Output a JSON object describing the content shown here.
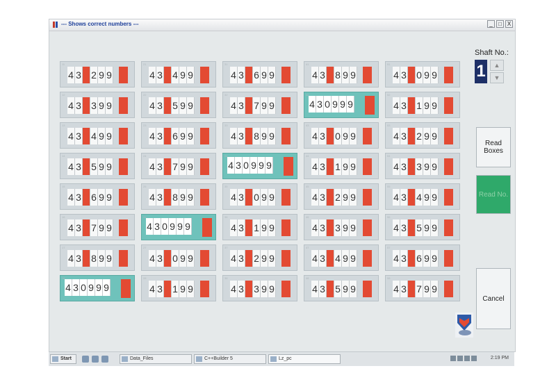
{
  "window": {
    "title": "--- Shows correct numbers ---",
    "controls": {
      "minimize": "_",
      "maximize": "□",
      "close": "X"
    }
  },
  "shaft": {
    "label": "Shaft No.:",
    "value": "1"
  },
  "buttons": {
    "read_boxes": "Read Boxes",
    "read_no": "Read No.",
    "cancel": "Cancel"
  },
  "boxes": [
    {
      "index": 11,
      "digits": [
        "4",
        "3",
        "0",
        "2",
        "9",
        "9"
      ],
      "highlighted": false
    },
    {
      "index": 21,
      "digits": [
        "4",
        "3",
        "0",
        "4",
        "9",
        "9"
      ],
      "highlighted": false
    },
    {
      "index": 31,
      "digits": [
        "4",
        "3",
        "0",
        "6",
        "9",
        "9"
      ],
      "highlighted": false
    },
    {
      "index": 41,
      "digits": [
        "4",
        "3",
        "0",
        "8",
        "9",
        "9"
      ],
      "highlighted": false
    },
    {
      "index": 51,
      "digits": [
        "4",
        "3",
        "0",
        "0",
        "9",
        "9"
      ],
      "highlighted": false
    },
    {
      "index": 12,
      "digits": [
        "4",
        "3",
        "0",
        "3",
        "9",
        "9"
      ],
      "highlighted": false
    },
    {
      "index": 22,
      "digits": [
        "4",
        "3",
        "0",
        "5",
        "9",
        "9"
      ],
      "highlighted": false
    },
    {
      "index": 32,
      "digits": [
        "4",
        "3",
        "0",
        "7",
        "9",
        "9"
      ],
      "highlighted": false
    },
    {
      "index": 42,
      "digits": [
        "4",
        "3",
        "0",
        "9",
        "9",
        "9"
      ],
      "highlighted": true
    },
    {
      "index": 52,
      "digits": [
        "4",
        "3",
        "0",
        "1",
        "9",
        "9"
      ],
      "highlighted": false
    },
    {
      "index": 13,
      "digits": [
        "4",
        "3",
        "0",
        "4",
        "9",
        "9"
      ],
      "highlighted": false
    },
    {
      "index": 23,
      "digits": [
        "4",
        "3",
        "0",
        "6",
        "9",
        "9"
      ],
      "highlighted": false
    },
    {
      "index": 33,
      "digits": [
        "4",
        "3",
        "0",
        "8",
        "9",
        "9"
      ],
      "highlighted": false
    },
    {
      "index": 43,
      "digits": [
        "4",
        "3",
        "0",
        "0",
        "9",
        "9"
      ],
      "highlighted": false
    },
    {
      "index": 53,
      "digits": [
        "4",
        "3",
        "0",
        "2",
        "9",
        "9"
      ],
      "highlighted": false
    },
    {
      "index": 14,
      "digits": [
        "4",
        "3",
        "0",
        "5",
        "9",
        "9"
      ],
      "highlighted": false
    },
    {
      "index": 24,
      "digits": [
        "4",
        "3",
        "0",
        "7",
        "9",
        "9"
      ],
      "highlighted": false
    },
    {
      "index": 34,
      "digits": [
        "4",
        "3",
        "0",
        "9",
        "9",
        "9"
      ],
      "highlighted": true
    },
    {
      "index": 44,
      "digits": [
        "4",
        "3",
        "0",
        "1",
        "9",
        "9"
      ],
      "highlighted": false
    },
    {
      "index": 54,
      "digits": [
        "4",
        "3",
        "0",
        "3",
        "9",
        "9"
      ],
      "highlighted": false
    },
    {
      "index": 15,
      "digits": [
        "4",
        "3",
        "0",
        "6",
        "9",
        "9"
      ],
      "highlighted": false
    },
    {
      "index": 25,
      "digits": [
        "4",
        "3",
        "0",
        "8",
        "9",
        "9"
      ],
      "highlighted": false
    },
    {
      "index": 35,
      "digits": [
        "4",
        "3",
        "0",
        "0",
        "9",
        "9"
      ],
      "highlighted": false
    },
    {
      "index": 45,
      "digits": [
        "4",
        "3",
        "0",
        "2",
        "9",
        "9"
      ],
      "highlighted": false
    },
    {
      "index": 55,
      "digits": [
        "4",
        "3",
        "0",
        "4",
        "9",
        "9"
      ],
      "highlighted": false
    },
    {
      "index": 16,
      "digits": [
        "4",
        "3",
        "0",
        "7",
        "9",
        "9"
      ],
      "highlighted": false
    },
    {
      "index": 26,
      "digits": [
        "4",
        "3",
        "0",
        "9",
        "9",
        "9"
      ],
      "highlighted": true
    },
    {
      "index": 36,
      "digits": [
        "4",
        "3",
        "0",
        "1",
        "9",
        "9"
      ],
      "highlighted": false
    },
    {
      "index": 46,
      "digits": [
        "4",
        "3",
        "0",
        "3",
        "9",
        "9"
      ],
      "highlighted": false
    },
    {
      "index": 56,
      "digits": [
        "4",
        "3",
        "0",
        "5",
        "9",
        "9"
      ],
      "highlighted": false
    },
    {
      "index": 17,
      "digits": [
        "4",
        "3",
        "0",
        "8",
        "9",
        "9"
      ],
      "highlighted": false
    },
    {
      "index": 27,
      "digits": [
        "4",
        "3",
        "0",
        "0",
        "9",
        "9"
      ],
      "highlighted": false
    },
    {
      "index": 37,
      "digits": [
        "4",
        "3",
        "0",
        "2",
        "9",
        "9"
      ],
      "highlighted": false
    },
    {
      "index": 47,
      "digits": [
        "4",
        "3",
        "0",
        "4",
        "9",
        "9"
      ],
      "highlighted": false
    },
    {
      "index": 57,
      "digits": [
        "4",
        "3",
        "0",
        "6",
        "9",
        "9"
      ],
      "highlighted": false
    },
    {
      "index": 18,
      "digits": [
        "4",
        "3",
        "0",
        "9",
        "9",
        "9"
      ],
      "highlighted": true
    },
    {
      "index": 28,
      "digits": [
        "4",
        "3",
        "0",
        "1",
        "9",
        "9"
      ],
      "highlighted": false
    },
    {
      "index": 38,
      "digits": [
        "4",
        "3",
        "0",
        "3",
        "9",
        "9"
      ],
      "highlighted": false
    },
    {
      "index": 48,
      "digits": [
        "4",
        "3",
        "0",
        "5",
        "9",
        "9"
      ],
      "highlighted": false
    },
    {
      "index": 58,
      "digits": [
        "4",
        "3",
        "0",
        "7",
        "9",
        "9"
      ],
      "highlighted": false
    }
  ],
  "taskbar": {
    "start": "Start",
    "items": [
      "Data_Files",
      "C++Builder 5",
      "Lz_pc"
    ],
    "clock": "2:19 PM"
  },
  "colors": {
    "digit_marker": "#e34a33",
    "highlight": "#6fc2bb",
    "read_no_button": "#2fa96a",
    "shaft_value_bg": "#1d2f66"
  }
}
